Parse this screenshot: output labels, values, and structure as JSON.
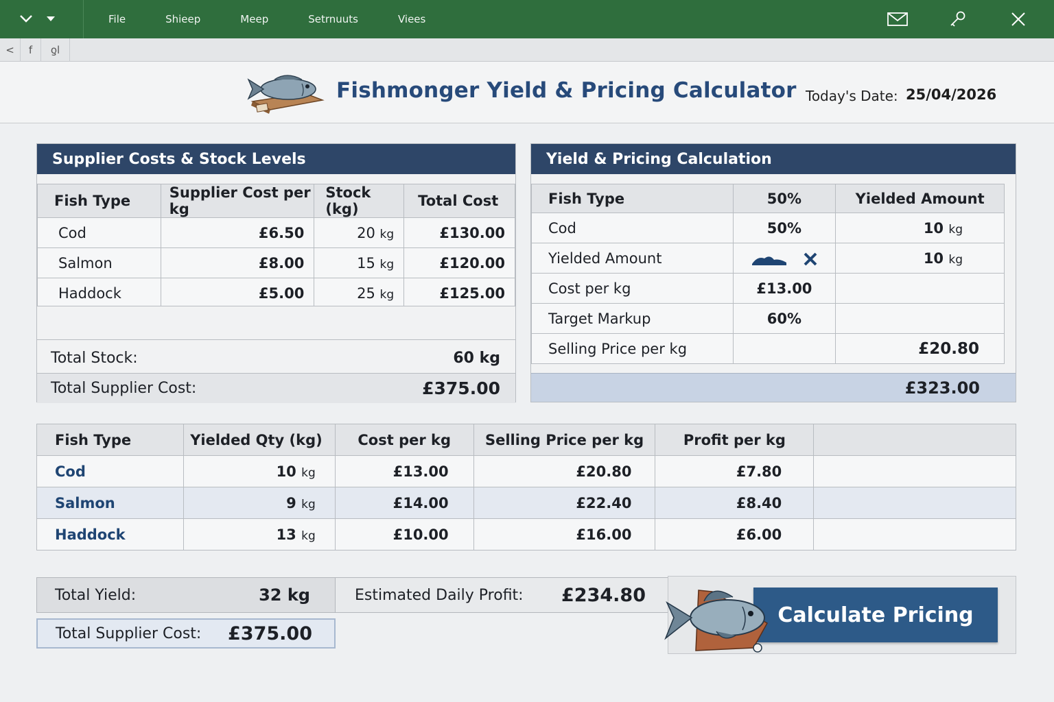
{
  "titlebar": {
    "menu": [
      "File",
      "Shieep",
      "Meep",
      "Setrnuuts",
      "Viees"
    ]
  },
  "quickbar": {
    "buttons": [
      "<",
      "f",
      "ƍl"
    ]
  },
  "header": {
    "title": "Fishmonger Yield & Pricing Calculator",
    "date_label": "Today's Date:",
    "date_value": "25/04/2026"
  },
  "supplier": {
    "title": "Supplier Costs & Stock Levels",
    "columns": [
      "Fish Type",
      "Supplier Cost per kg",
      "Stock (kg)",
      "Total Cost"
    ],
    "rows": [
      {
        "fish": "Cod",
        "cost": "£6.50",
        "stock": "20",
        "unit": "kg",
        "total": "£130.00"
      },
      {
        "fish": "Salmon",
        "cost": "£8.00",
        "stock": "15",
        "unit": "kg",
        "total": "£120.00"
      },
      {
        "fish": "Haddock",
        "cost": "£5.00",
        "stock": "25",
        "unit": "kg",
        "total": "£125.00"
      }
    ],
    "total_stock_label": "Total Stock:",
    "total_stock_value": "60 kg",
    "total_cost_label": "Total Supplier Cost:",
    "total_cost_value": "£375.00"
  },
  "yield": {
    "title": "Yield & Pricing Calculation",
    "columns": [
      "Fish Type",
      "50%",
      "Yielded Amount"
    ],
    "rows": [
      {
        "label": "Cod",
        "mid": "50%",
        "amount": "10",
        "unit": "kg"
      },
      {
        "label": "Yielded Amount",
        "mid": "",
        "amount": "10",
        "unit": "kg"
      },
      {
        "label": "Cost per kg",
        "mid": "£13.00",
        "amount": "",
        "unit": ""
      },
      {
        "label": "Target Markup",
        "mid": "60%",
        "amount": "",
        "unit": ""
      },
      {
        "label": "Selling Price per kg",
        "mid": "",
        "amount": "£20.80",
        "unit": ""
      }
    ],
    "total": "£323.00"
  },
  "profit": {
    "columns": [
      "Fish Type",
      "Yielded Qty (kg)",
      "Cost per kg",
      "Selling Price per kg",
      "Profit per kg",
      ""
    ],
    "rows": [
      {
        "fish": "Cod",
        "qty": "10",
        "unit": "kg",
        "cost": "£13.00",
        "sell": "£20.80",
        "profit": "£7.80"
      },
      {
        "fish": "Salmon",
        "qty": "9",
        "unit": "kg",
        "cost": "£14.00",
        "sell": "£22.40",
        "profit": "£8.40"
      },
      {
        "fish": "Haddock",
        "qty": "13",
        "unit": "kg",
        "cost": "£10.00",
        "sell": "£16.00",
        "profit": "£6.00"
      }
    ]
  },
  "summary": {
    "total_yield_label": "Total Yield:",
    "total_yield_value": "32 kg",
    "daily_profit_label": "Estimated Daily Profit:",
    "daily_profit_value": "£234.80",
    "total_cost_label": "Total Supplier Cost:",
    "total_cost_value": "£375.00"
  },
  "actions": {
    "calculate_label": "Calculate Pricing"
  },
  "colors": {
    "titlebar": "#2f6e3d",
    "panel_header": "#2e4668",
    "title_text": "#274a7a",
    "button": "#2d5a88",
    "highlight_row": "#c8d3e4"
  },
  "icons": [
    "chevron-down-icon",
    "dropdown-arrow-icon",
    "mail-icon",
    "key-icon",
    "close-icon",
    "fish-logo-icon",
    "wave-icon",
    "tool-icon",
    "fish-icon"
  ]
}
